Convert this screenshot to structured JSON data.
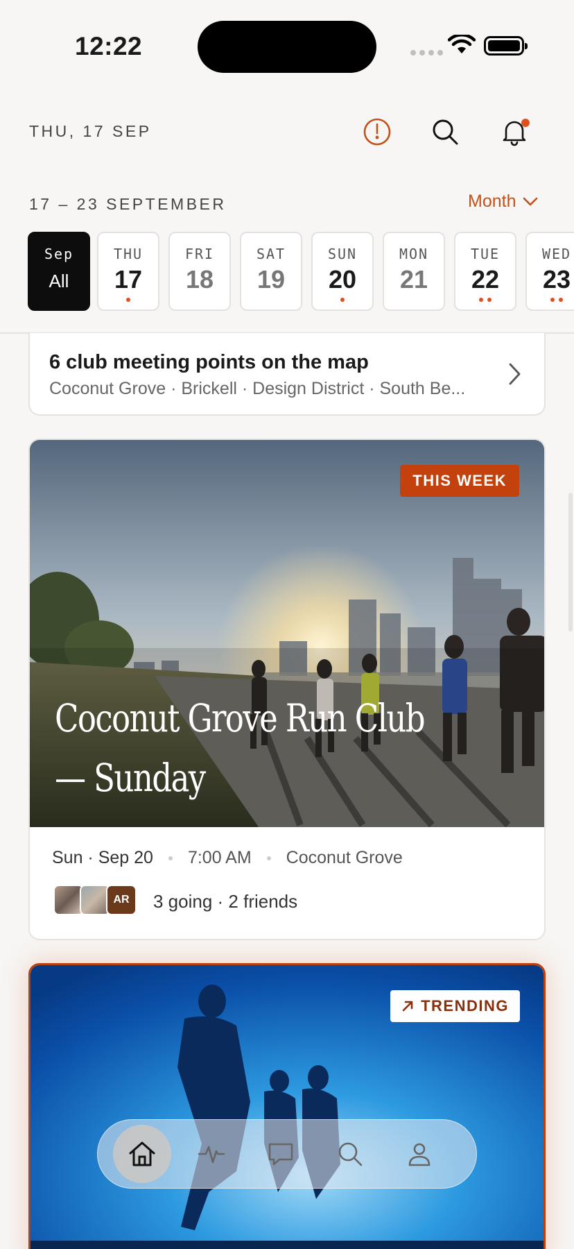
{
  "status_bar": {
    "time": "12:22"
  },
  "header": {
    "date": "THU, 17 SEP",
    "icons": [
      "compass-icon",
      "search-icon",
      "bell-icon"
    ],
    "has_notification": true
  },
  "calendar": {
    "range_label": "17 – 23 SEPTEMBER",
    "view_selector": "Month",
    "all_chip": {
      "month": "Sep",
      "label": "All"
    },
    "days": [
      {
        "dow": "THU",
        "num": "17",
        "events": 1
      },
      {
        "dow": "FRI",
        "num": "18",
        "events": 0
      },
      {
        "dow": "SAT",
        "num": "19",
        "events": 0
      },
      {
        "dow": "SUN",
        "num": "20",
        "events": 1
      },
      {
        "dow": "MON",
        "num": "21",
        "events": 0
      },
      {
        "dow": "TUE",
        "num": "22",
        "events": 2
      },
      {
        "dow": "WED",
        "num": "23",
        "events": 2
      }
    ]
  },
  "map_card": {
    "title": "6 club meeting points on the map",
    "subtitle": "Coconut Grove · Brickell · Design District · South Be..."
  },
  "event_card": {
    "badge": "THIS WEEK",
    "title_line1": "Coconut Grove Run Club",
    "title_line2": "— Sunday",
    "date": "Sun · Sep 20",
    "time": "7:00 AM",
    "location": "Coconut Grove",
    "avatar_initials": "AR",
    "attendance": "3 going · 2 friends"
  },
  "trending_card": {
    "badge": "TRENDING"
  },
  "tab_bar": {
    "tabs": [
      "home-icon",
      "activity-icon",
      "chat-icon",
      "search-icon",
      "profile-icon"
    ],
    "active": "home-icon"
  },
  "colors": {
    "accent": "#c2511a",
    "badge_week": "#c2410c",
    "dot": "#e0501f"
  }
}
